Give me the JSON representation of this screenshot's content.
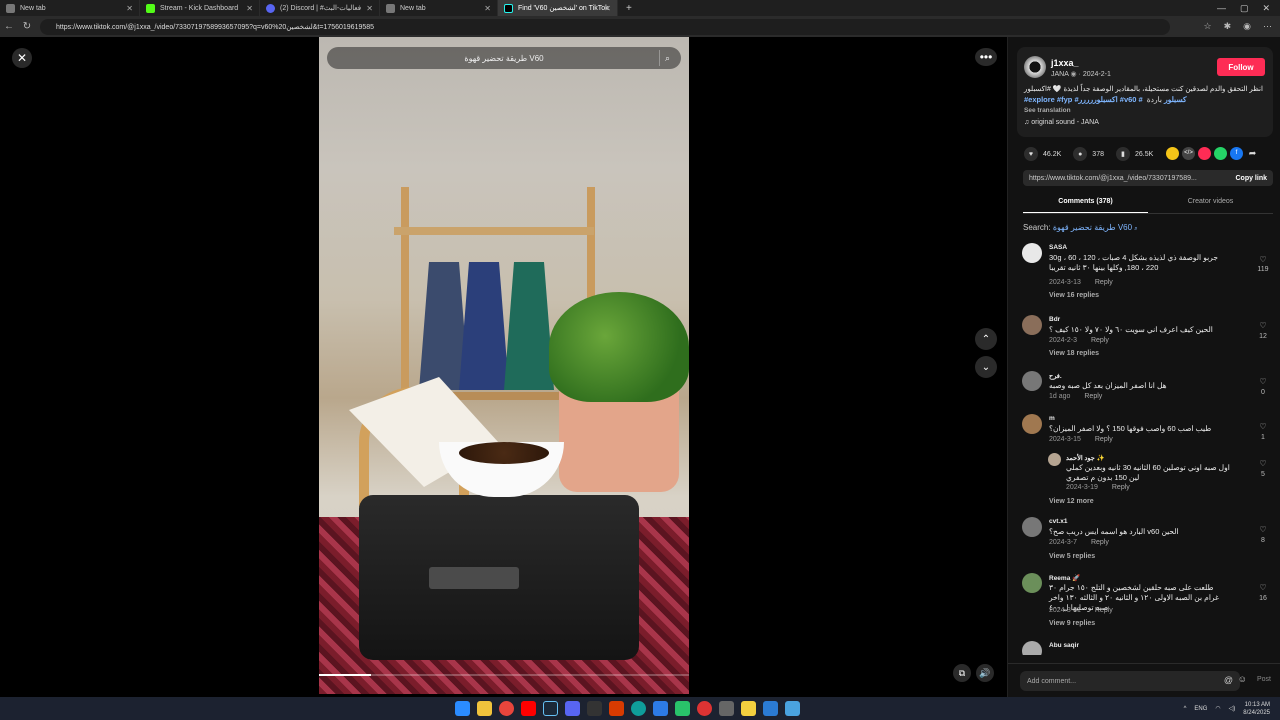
{
  "browser": {
    "tabs": [
      {
        "label": "New tab",
        "color": "#888"
      },
      {
        "label": "Stream - Kick Dashboard",
        "color": "#53fc18"
      },
      {
        "label": "(2) Discord | #فعاليات-البث",
        "color": "#5865f2"
      },
      {
        "label": "New tab",
        "color": "#888"
      },
      {
        "label": "Find 'V60 لشخصين' on TikTok",
        "color": "#222"
      }
    ],
    "url": "https://www.tiktok.com/@j1xxa_/video/7330719758993657095?q=v60%20لشخصين&t=1756019619585"
  },
  "video": {
    "search_text": "طريقة تحضير قهوة V60"
  },
  "author": {
    "handle": "j1xxa_",
    "name": "JANA",
    "date": "2024-2-1",
    "follow_label": "Follow",
    "description": "انظر التحقق والدم لصدقين كنت مستحيلة، بالمقادير الوصفة جداً لذيذة 🤍 #اكسبلور",
    "hashtags": "#explore #fyp #اكسبلوررررر #v60 #كسبلور",
    "hashtags_tail": "باردة",
    "see_translation": "See translation",
    "sound": "original sound - JANA"
  },
  "stats": {
    "likes": "46.2K",
    "comments": "378",
    "saves": "26.5K"
  },
  "share": {
    "link": "https://www.tiktok.com/@j1xxa_/video/73307197589...",
    "copy_label": "Copy link"
  },
  "panel_tabs": {
    "comments": "Comments (378)",
    "creator": "Creator videos"
  },
  "search": {
    "prefix": "Search:",
    "query": "طريقة تحضير قهوة V60"
  },
  "comments": [
    {
      "user": "SASA",
      "text": "جربو الوصفة ذي لذيذه بشكل 4 صبات 30g ، 60 ، 120 ، 180 ، 220, وكلها بينها ٣٠ ثانيه تقريبا",
      "date": "2024-3-13",
      "reply": "Reply",
      "replies": "View 16 replies",
      "likes": "119",
      "color": "#e8e8e8"
    },
    {
      "user": "Bdr",
      "text": "الحين كيف اعرف اني سويت ٦٠ ولا ٧٠ ولا ١٥٠ كيف ؟",
      "date": "2024-2-3",
      "reply": "Reply",
      "replies": "View 18 replies",
      "likes": "12",
      "color": "#8a6e5a"
    },
    {
      "user": "فرح.",
      "text": "هل انا اصفر الميزان بعد كل صبه وصبه",
      "date": "1d ago",
      "reply": "Reply",
      "replies": "",
      "likes": "0",
      "color": "#777"
    },
    {
      "user": "m",
      "text": "طيب اصب 60 واصب فوقها 150 ؟ ولا اصفر الميزان؟",
      "date": "2024-3-15",
      "reply": "Reply",
      "replies": "",
      "likes": "1",
      "color": "#a07850"
    },
    {
      "user": "جود الأحمد ✨",
      "text": "اول صبه اوني توصلين 60 الثانيه 30 ثانيه وبعدين كملي لين 150 بدون م تصفري",
      "date": "2024-3-19",
      "reply": "Reply",
      "replies": "View 12 more",
      "likes": "5",
      "color": "#b5a491"
    },
    {
      "user": "cvt.x1",
      "text": "الحين v60 البارد هو اسمه ايس دريب صح؟",
      "date": "2024-3-7",
      "reply": "Reply",
      "replies": "View 5 replies",
      "likes": "8",
      "color": "#777"
    },
    {
      "user": "Reema 🚀",
      "text": "طلعت على صبه حلقين لشخصين و التلج ١٥٠ جرام ٣٠ غرام بن الصبه الاولى ١٢٠ و الثانيه ٢٠ و الثالثه ١٣٠ واخر صبه توصليها ل ٤٠٠",
      "date": "2024-3-31",
      "reply": "Reply",
      "replies": "View 9 replies",
      "likes": "16",
      "color": "#6b8f5a"
    },
    {
      "user": "Abu saqir",
      "text": "",
      "date": "",
      "reply": "",
      "replies": "",
      "likes": "",
      "color": "#aaa"
    }
  ],
  "composer": {
    "placeholder": "Add comment...",
    "post_label": "Post"
  },
  "taskbar": {
    "lang": "ENG",
    "time": "10:13 AM",
    "date": "8/24/2025"
  }
}
